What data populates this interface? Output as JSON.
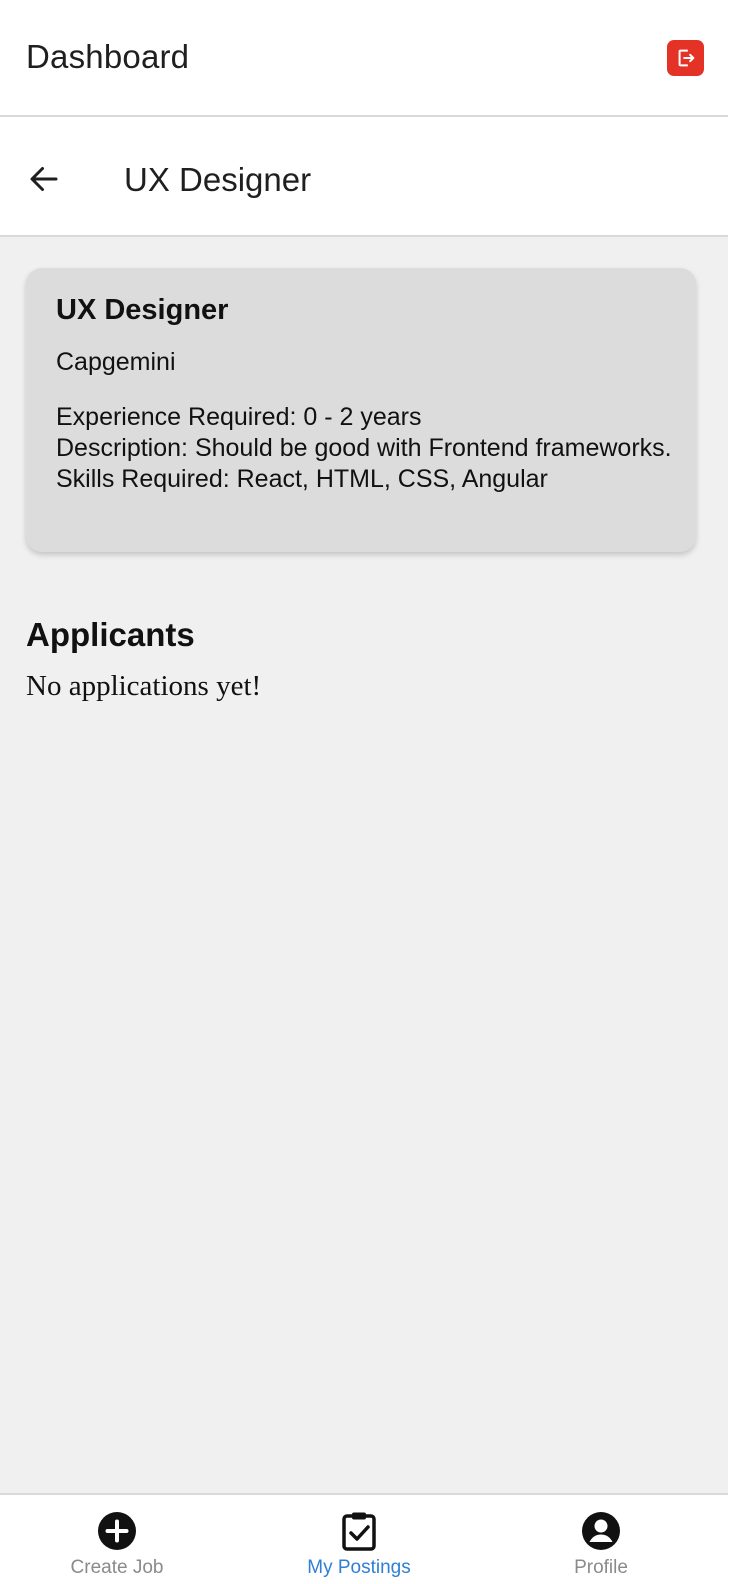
{
  "header": {
    "title": "Dashboard",
    "logout_icon": "logout-icon",
    "accent_color": "#e53227"
  },
  "subheader": {
    "back_icon": "arrow-left-icon",
    "title": "UX Designer"
  },
  "job": {
    "title": "UX Designer",
    "company": "Capgemini",
    "experience": "Experience Required: 0 - 2 years",
    "description": "Description: Should be good with Frontend frameworks.",
    "skills": "Skills Required: React, HTML, CSS, Angular"
  },
  "applicants": {
    "heading": "Applicants",
    "empty_text": "No applications yet!"
  },
  "bottom_nav": {
    "active_color": "#2f7fd6",
    "items": [
      {
        "label": "Create Job",
        "icon": "plus-circle-icon",
        "active": false
      },
      {
        "label": "My Postings",
        "icon": "clipboard-check-icon",
        "active": true
      },
      {
        "label": "Profile",
        "icon": "user-circle-icon",
        "active": false
      }
    ]
  }
}
